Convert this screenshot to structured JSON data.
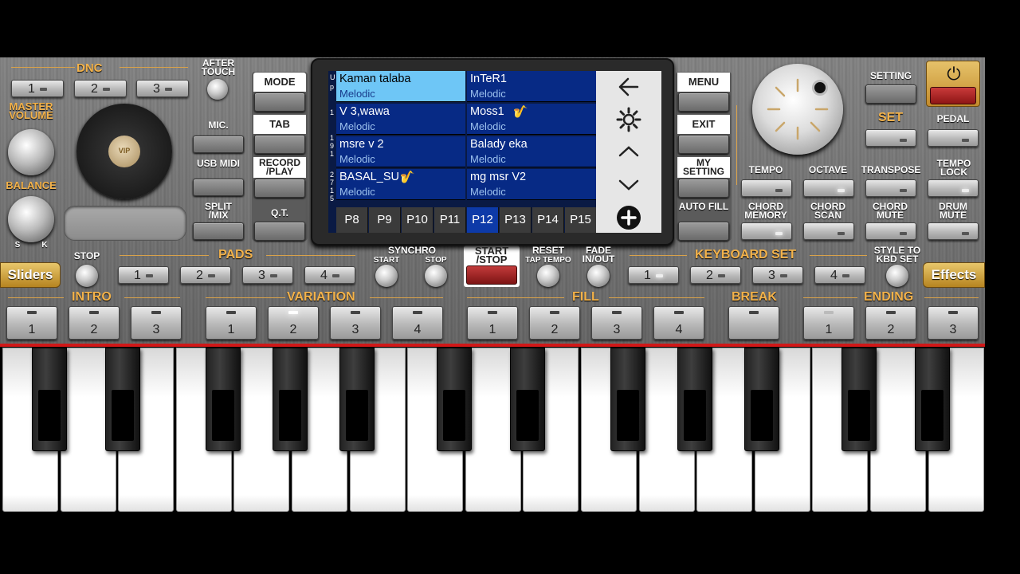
{
  "colors": {
    "accent": "#f3b24a",
    "selected_slot": "#6ec6f6",
    "slot": "#072a85",
    "power": "#b21c1c"
  },
  "top_left": {
    "dnc": "DNC",
    "dnc_buttons": [
      "1",
      "2",
      "3"
    ],
    "after_touch": "AFTER TOUCH",
    "master_volume": "MASTER VOLUME",
    "balance": "BALANCE",
    "balance_s": "S",
    "balance_k": "K",
    "mic": "MIC.",
    "usb_midi": "USB MIDI",
    "split_mix": "SPLIT /MIX",
    "logo_text": "VIP"
  },
  "modes": {
    "mode": "MODE",
    "tab": "TAB",
    "record_play": "RECORD /PLAY",
    "qt": "Q.T."
  },
  "display": {
    "side_letters": [
      "U",
      "p",
      "1",
      "1",
      "9",
      "1",
      "2",
      "7",
      "1",
      "5"
    ],
    "slots": [
      {
        "name": "Kaman talaba",
        "cat": "Melodic"
      },
      {
        "name": "InTeR1",
        "cat": "Melodic"
      },
      {
        "name": "V 3,wawa",
        "cat": "Melodic"
      },
      {
        "name": "Moss1",
        "cat": "Melodic",
        "icon": "sax-icon"
      },
      {
        "name": "msre v 2",
        "cat": "Melodic"
      },
      {
        "name": "Balady eka",
        "cat": "Melodic"
      },
      {
        "name": "BASAL_SU",
        "cat": "Melodic",
        "icon": "sax-icon"
      },
      {
        "name": "mg msr V2",
        "cat": "Melodic"
      }
    ],
    "pages": [
      "P8",
      "P9",
      "P10",
      "P11",
      "P12",
      "P13",
      "P14",
      "P15"
    ],
    "selected_page": "P12",
    "nav_icons": [
      "back-arrow-icon",
      "gear-icon",
      "chevron-up-icon",
      "chevron-down-icon",
      "plus-icon"
    ]
  },
  "right_menu": {
    "menu": "MENU",
    "exit": "EXIT",
    "my_setting": "MY SETTING",
    "auto_fill": "AUTO FILL"
  },
  "top_right": {
    "setting": "SETTING",
    "set": "SET",
    "pedal": "PEDAL",
    "tempo": "TEMPO",
    "octave": "OCTAVE",
    "transpose": "TRANSPOSE",
    "tempo_lock": "TEMPO LOCK",
    "chord_memory": "CHORD MEMORY",
    "chord_scan": "CHORD SCAN",
    "chord_mute": "CHORD MUTE",
    "drum_mute": "DRUM MUTE"
  },
  "row2": {
    "sliders": "Sliders",
    "stop": "STOP",
    "pads": "PADS",
    "pad_buttons": [
      "1",
      "2",
      "3",
      "4"
    ],
    "synchro": "SYNCHRO",
    "synchro_start": "START",
    "synchro_stop": "STOP",
    "start_stop": "START /STOP",
    "reset": "RESET",
    "tap_tempo": "TAP TEMPO",
    "fade": "FADE IN/OUT",
    "keyboard_set": "KEYBOARD SET",
    "kbd_buttons": [
      "1",
      "2",
      "3",
      "4"
    ],
    "style_to_kbd": "STYLE TO KBD SET",
    "effects": "Effects"
  },
  "row3": {
    "intro": "INTRO",
    "intro_buttons": [
      "1",
      "2",
      "3"
    ],
    "variation": "VARIATION",
    "variation_buttons": [
      "1",
      "2",
      "3",
      "4"
    ],
    "fill": "FILL",
    "fill_buttons": [
      "1",
      "2",
      "3",
      "4"
    ],
    "break": "BREAK",
    "ending": "ENDING",
    "ending_buttons": [
      "1",
      "2",
      "3"
    ]
  }
}
